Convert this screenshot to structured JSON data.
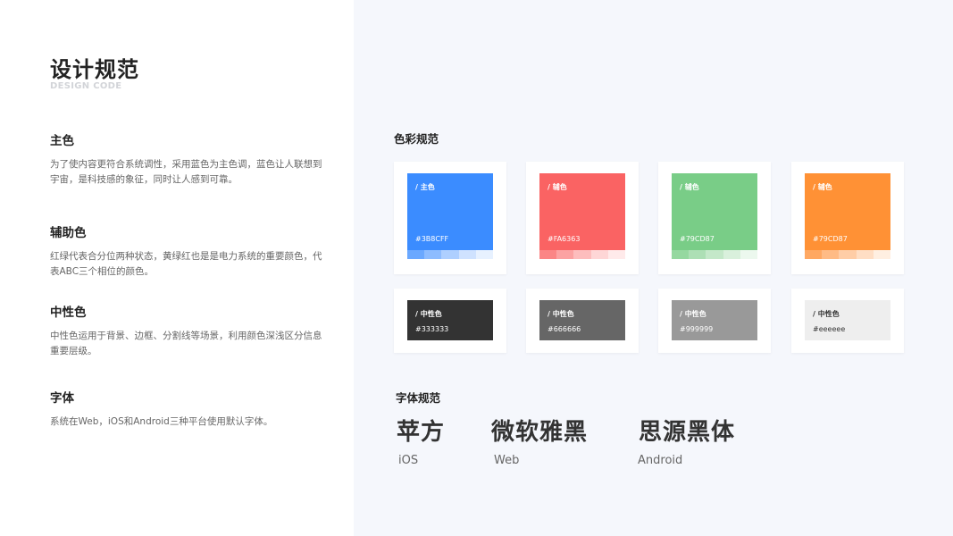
{
  "header": {
    "title": "设计规范",
    "subtitle": "DESIGN CODE"
  },
  "left_sections": [
    {
      "heading": "主色",
      "body": "为了使内容更符合系统调性，采用蓝色为主色调，蓝色让人联想到宇宙，是科技感的象征，同时让人感到可靠。"
    },
    {
      "heading": "辅助色",
      "body": "红绿代表合分位两种状态，黄绿红也是是电力系统的重要颜色，代表ABC三个相位的颜色。"
    },
    {
      "heading": "中性色",
      "body": "中性色运用于背景、边框、分割线等场景，利用颜色深浅区分信息重要层级。"
    },
    {
      "heading": "字体",
      "body": "系统在Web，iOS和Android三种平台使用默认字体。"
    }
  ],
  "color_section": {
    "label": "色彩规范",
    "primary_cards": [
      {
        "tag": "/ 主色",
        "hex": "#3B8CFF",
        "color": "#3b8cff",
        "tints": [
          "#6aa8ff",
          "#8dbcff",
          "#aecfff",
          "#cfe2ff",
          "#e7f1ff"
        ]
      },
      {
        "tag": "/ 辅色",
        "hex": "#FA6363",
        "color": "#fa6363",
        "tints": [
          "#fb8585",
          "#fca2a2",
          "#fdbdbd",
          "#fed6d6",
          "#ffeaea"
        ]
      },
      {
        "tag": "/ 辅色",
        "hex": "#79CD87",
        "color": "#79cd87",
        "tints": [
          "#95d8a0",
          "#addfb5",
          "#c4e8c9",
          "#d9f0dc",
          "#ecf8ee"
        ]
      },
      {
        "tag": "/ 辅色",
        "hex": "#79CD87",
        "color": "#ff9135",
        "tints": [
          "#ffa862",
          "#ffbb85",
          "#ffcda6",
          "#ffdec4",
          "#ffefe1"
        ]
      }
    ],
    "neutral_cards": [
      {
        "tag": "/ 中性色",
        "hex": "#333333",
        "color": "#333333"
      },
      {
        "tag": "/ 中性色",
        "hex": "#666666",
        "color": "#666666"
      },
      {
        "tag": "/ 中性色",
        "hex": "#999999",
        "color": "#999999"
      },
      {
        "tag": "/ 中性色",
        "hex": "#eeeeee",
        "color": "#eeeeee"
      }
    ]
  },
  "font_section": {
    "label": "字体规范",
    "fonts": [
      {
        "name": "苹方",
        "platform": "iOS"
      },
      {
        "name": "微软雅黑",
        "platform": "Web"
      },
      {
        "name": "思源黑体",
        "platform": "Android"
      }
    ]
  }
}
